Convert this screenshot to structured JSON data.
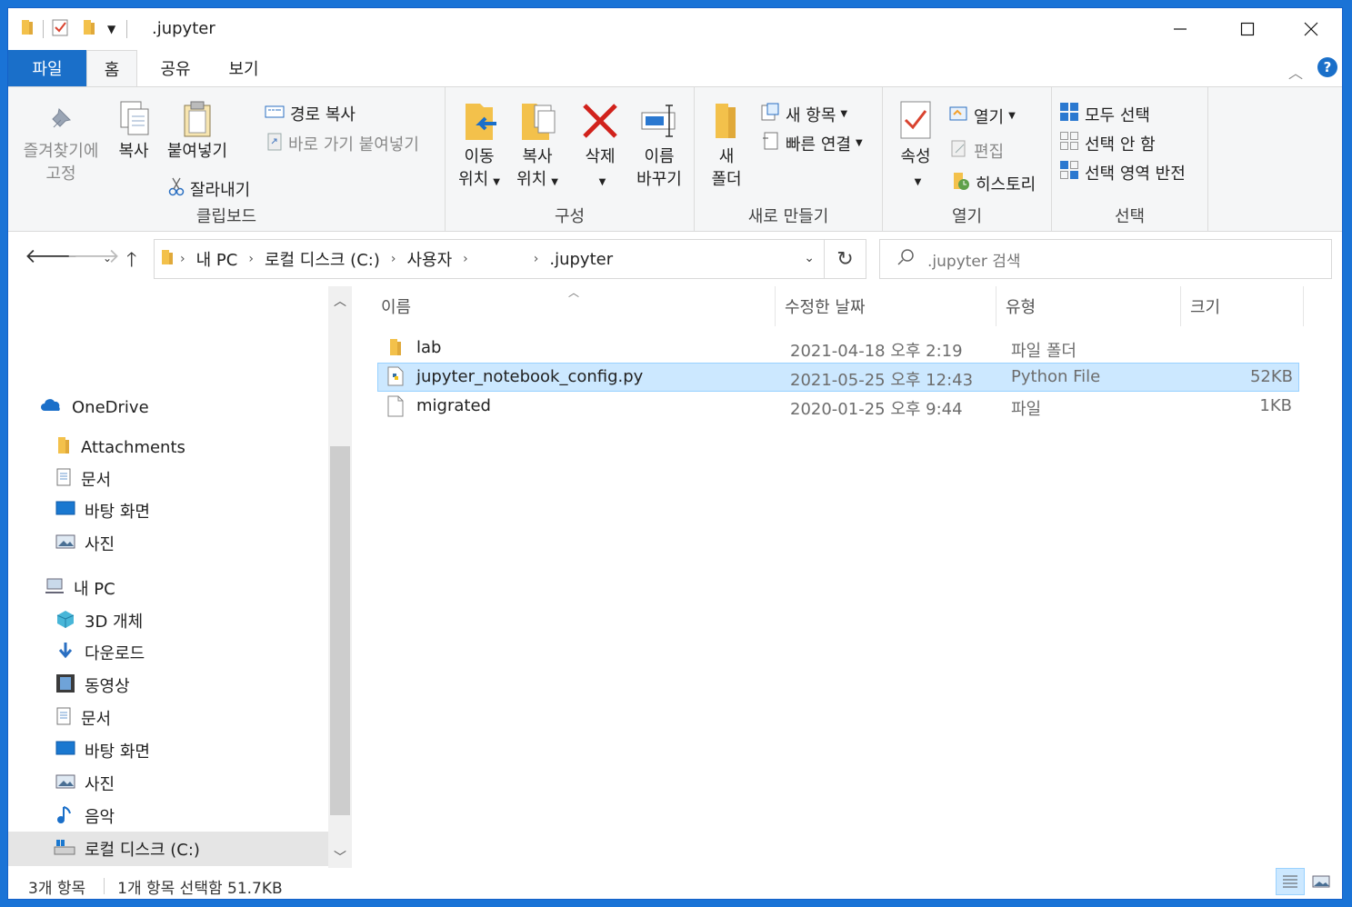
{
  "window": {
    "title": ".jupyter",
    "controls": {
      "minimize": "—",
      "maximize": "☐",
      "close": "✕"
    }
  },
  "ribbon_tabs": [
    {
      "label": "파일"
    },
    {
      "label": "홈"
    },
    {
      "label": "공유"
    },
    {
      "label": "보기"
    }
  ],
  "ribbon": {
    "clipboard": {
      "label": "클립보드",
      "pin_line1": "즐겨찾기에",
      "pin_line2": "고정",
      "copy": "복사",
      "paste": "붙여넣기",
      "copy_path": "경로 복사",
      "paste_shortcut": "바로 가기 붙여넣기",
      "cut": "잘라내기"
    },
    "organize": {
      "label": "구성",
      "move_line1": "이동",
      "move_line2": "위치",
      "copyto_line1": "복사",
      "copyto_line2": "위치",
      "delete": "삭제",
      "rename_line1": "이름",
      "rename_line2": "바꾸기"
    },
    "new": {
      "label": "새로 만들기",
      "folder_line1": "새",
      "folder_line2": "폴더",
      "new_item": "새 항목",
      "easy_access": "빠른 연결"
    },
    "open": {
      "label": "열기",
      "properties": "속성",
      "open": "열기",
      "edit": "편집",
      "history": "히스토리"
    },
    "select": {
      "label": "선택",
      "select_all": "모두 선택",
      "select_none": "선택 안 함",
      "invert": "선택 영역 반전"
    }
  },
  "address": {
    "crumbs": [
      "내 PC",
      "로컬 디스크 (C:)",
      "사용자",
      "",
      ".jupyter"
    ],
    "search_placeholder": ".jupyter 검색"
  },
  "nav": {
    "onedrive": "OneDrive",
    "onedrive_items": [
      "Attachments",
      "문서",
      "바탕 화면",
      "사진"
    ],
    "pc": "내 PC",
    "pc_items": [
      "3D 개체",
      "다운로드",
      "동영상",
      "문서",
      "바탕 화면",
      "사진",
      "음악",
      "로컬 디스크 (C:)"
    ]
  },
  "columns": {
    "name": "이름",
    "modified": "수정한 날짜",
    "type": "유형",
    "size": "크기"
  },
  "files": [
    {
      "name": "lab",
      "modified": "2021-04-18 오후 2:19",
      "type": "파일 폴더",
      "size": "",
      "icon": "folder-icon",
      "selected": false
    },
    {
      "name": "jupyter_notebook_config.py",
      "modified": "2021-05-25 오후 12:43",
      "type": "Python File",
      "size": "52KB",
      "icon": "python-file-icon",
      "selected": true
    },
    {
      "name": "migrated",
      "modified": "2020-01-25 오후 9:44",
      "type": "파일",
      "size": "1KB",
      "icon": "file-icon",
      "selected": false
    }
  ],
  "status": {
    "count": "3개 항목",
    "selection": "1개 항목 선택함 51.7KB"
  },
  "colors": {
    "accent": "#1a6fc9",
    "selection": "#cce8ff",
    "folder": "#f3c14b"
  }
}
